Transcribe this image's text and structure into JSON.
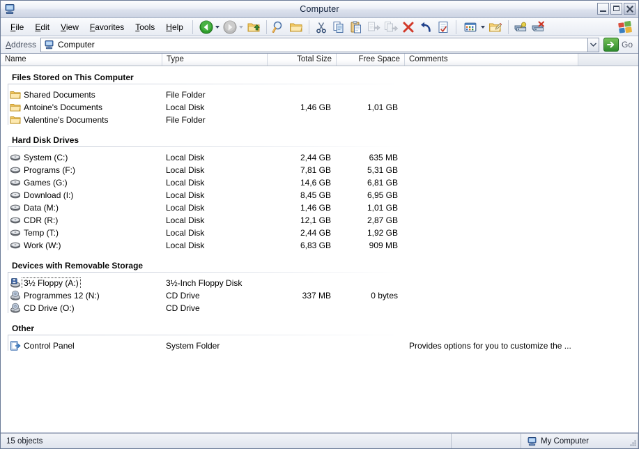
{
  "window": {
    "title": "Computer",
    "system_icon": "my-computer-icon",
    "buttons": [
      {
        "name": "minimize-button",
        "glyph": "minimize"
      },
      {
        "name": "maximize-button",
        "glyph": "maximize"
      },
      {
        "name": "close-button",
        "glyph": "close"
      }
    ]
  },
  "menubar": {
    "items": [
      {
        "name": "file",
        "label": "File",
        "accel": "F"
      },
      {
        "name": "edit",
        "label": "Edit",
        "accel": "E"
      },
      {
        "name": "view",
        "label": "View",
        "accel": "V"
      },
      {
        "name": "favorites",
        "label": "Favorites",
        "accel": "F"
      },
      {
        "name": "tools",
        "label": "Tools",
        "accel": "T"
      },
      {
        "name": "help",
        "label": "Help",
        "accel": "H"
      }
    ]
  },
  "toolbar": {
    "buttons": [
      {
        "name": "back-button",
        "icon": "back-arrow-icon",
        "state": "enabled"
      },
      {
        "name": "back-dropdown",
        "icon": "chevron-down-icon",
        "state": "enabled"
      },
      {
        "name": "forward-button",
        "icon": "forward-arrow-icon",
        "state": "disabled"
      },
      {
        "name": "forward-dropdown",
        "icon": "chevron-down-icon",
        "state": "disabled"
      },
      {
        "name": "up-button",
        "icon": "up-folder-icon",
        "state": "enabled"
      },
      {
        "name": "search-button",
        "icon": "search-icon",
        "state": "enabled"
      },
      {
        "name": "folders-button",
        "icon": "folders-icon",
        "state": "enabled"
      },
      {
        "name": "cut-button",
        "icon": "scissors-icon",
        "state": "enabled"
      },
      {
        "name": "copy-button",
        "icon": "copy-icon",
        "state": "enabled"
      },
      {
        "name": "paste-button",
        "icon": "paste-icon",
        "state": "enabled"
      },
      {
        "name": "move-to-button",
        "icon": "move-to-folder-icon",
        "state": "disabled"
      },
      {
        "name": "copy-to-button",
        "icon": "copy-to-folder-icon",
        "state": "disabled"
      },
      {
        "name": "delete-button",
        "icon": "delete-x-icon",
        "state": "enabled"
      },
      {
        "name": "undo-button",
        "icon": "undo-arrow-icon",
        "state": "enabled"
      },
      {
        "name": "properties-button",
        "icon": "properties-icon",
        "state": "enabled"
      },
      {
        "name": "views-button",
        "icon": "views-icon",
        "state": "enabled"
      },
      {
        "name": "views-dropdown",
        "icon": "chevron-down-icon",
        "state": "enabled"
      },
      {
        "name": "folder-options-button",
        "icon": "folder-pencil-icon",
        "state": "enabled"
      },
      {
        "name": "map-drive-button",
        "icon": "map-network-drive-icon",
        "state": "enabled"
      },
      {
        "name": "disconnect-drive-button",
        "icon": "disconnect-network-drive-icon",
        "state": "enabled"
      }
    ],
    "brand_icon": "windows-flag-icon"
  },
  "address": {
    "label": "Address",
    "icon": "my-computer-icon",
    "value": "Computer",
    "placeholder": "Computer",
    "dropdown_icon": "chevron-down-icon",
    "go_label": "Go",
    "go_icon": "go-arrow-icon"
  },
  "columns": [
    {
      "name": "name",
      "label": "Name",
      "align": "left"
    },
    {
      "name": "type",
      "label": "Type",
      "align": "left"
    },
    {
      "name": "total-size",
      "label": "Total Size",
      "align": "right"
    },
    {
      "name": "free-space",
      "label": "Free Space",
      "align": "right"
    },
    {
      "name": "comments",
      "label": "Comments",
      "align": "left"
    }
  ],
  "groups": [
    {
      "name": "files-stored-on-this-computer",
      "title": "Files Stored on This Computer",
      "rows": [
        {
          "icon": "folder-icon",
          "name": "Shared Documents",
          "type": "File Folder",
          "total_size": "",
          "free_space": "",
          "comments": "",
          "focused": false
        },
        {
          "icon": "folder-icon",
          "name": "Antoine's Documents",
          "type": "Local Disk",
          "total_size": "1,46 GB",
          "free_space": "1,01 GB",
          "comments": "",
          "focused": false
        },
        {
          "icon": "folder-icon",
          "name": "Valentine's Documents",
          "type": "File Folder",
          "total_size": "",
          "free_space": "",
          "comments": "",
          "focused": false
        }
      ]
    },
    {
      "name": "hard-disk-drives",
      "title": "Hard Disk Drives",
      "rows": [
        {
          "icon": "hard-drive-icon",
          "name": "System (C:)",
          "type": "Local Disk",
          "total_size": "2,44 GB",
          "free_space": "635 MB",
          "comments": "",
          "focused": false
        },
        {
          "icon": "hard-drive-icon",
          "name": "Programs (F:)",
          "type": "Local Disk",
          "total_size": "7,81 GB",
          "free_space": "5,31 GB",
          "comments": "",
          "focused": false
        },
        {
          "icon": "hard-drive-icon",
          "name": "Games (G:)",
          "type": "Local Disk",
          "total_size": "14,6 GB",
          "free_space": "6,81 GB",
          "comments": "",
          "focused": false
        },
        {
          "icon": "hard-drive-icon",
          "name": "Download (I:)",
          "type": "Local Disk",
          "total_size": "8,45 GB",
          "free_space": "6,95 GB",
          "comments": "",
          "focused": false
        },
        {
          "icon": "hard-drive-icon",
          "name": "Data (M:)",
          "type": "Local Disk",
          "total_size": "1,46 GB",
          "free_space": "1,01 GB",
          "comments": "",
          "focused": false
        },
        {
          "icon": "hard-drive-icon",
          "name": "CDR (R:)",
          "type": "Local Disk",
          "total_size": "12,1 GB",
          "free_space": "2,87 GB",
          "comments": "",
          "focused": false
        },
        {
          "icon": "hard-drive-icon",
          "name": "Temp (T:)",
          "type": "Local Disk",
          "total_size": "2,44 GB",
          "free_space": "1,92 GB",
          "comments": "",
          "focused": false
        },
        {
          "icon": "hard-drive-icon",
          "name": "Work (W:)",
          "type": "Local Disk",
          "total_size": "6,83 GB",
          "free_space": "909 MB",
          "comments": "",
          "focused": false
        }
      ]
    },
    {
      "name": "devices-with-removable-storage",
      "title": "Devices with Removable Storage",
      "rows": [
        {
          "icon": "floppy-drive-icon",
          "name": "3½ Floppy (A:)",
          "type": "3½-Inch Floppy Disk",
          "total_size": "",
          "free_space": "",
          "comments": "",
          "focused": true
        },
        {
          "icon": "cd-drive-icon",
          "name": "Programmes 12 (N:)",
          "type": "CD Drive",
          "total_size": "337 MB",
          "free_space": "0 bytes",
          "comments": "",
          "focused": false
        },
        {
          "icon": "cd-drive-icon",
          "name": "CD Drive (O:)",
          "type": "CD Drive",
          "total_size": "",
          "free_space": "",
          "comments": "",
          "focused": false
        }
      ]
    },
    {
      "name": "other",
      "title": "Other",
      "rows": [
        {
          "icon": "control-panel-icon",
          "name": "Control Panel",
          "type": "System Folder",
          "total_size": "",
          "free_space": "",
          "comments": "Provides options for you to customize the ...",
          "focused": false
        }
      ]
    }
  ],
  "statusbar": {
    "object_count": "15 objects",
    "middle": "",
    "zone_icon": "my-computer-icon",
    "zone": "My Computer"
  },
  "colors": {
    "accent_green": "#2e8a2c",
    "delete_red": "#d23a2a",
    "folder_yellow": "#f5c85c",
    "frame_blue": "#6a7a96",
    "titlebar_text": "#12223c"
  }
}
